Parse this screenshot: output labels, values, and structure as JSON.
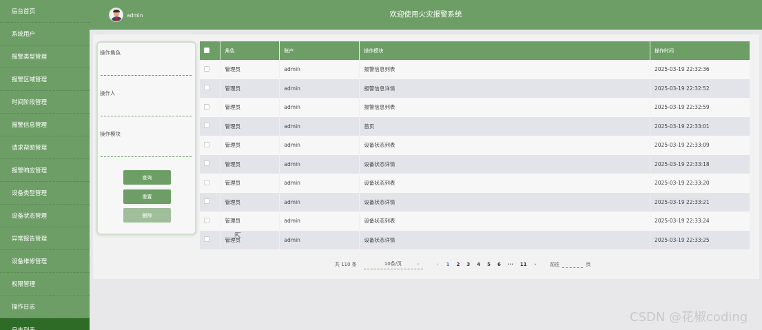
{
  "sidebar": {
    "items": [
      {
        "label": "后台首页"
      },
      {
        "label": "系统用户"
      },
      {
        "label": "报警类型管理"
      },
      {
        "label": "报警区域管理"
      },
      {
        "label": "时间阶段管理"
      },
      {
        "label": "报警信息管理"
      },
      {
        "label": "请求帮助管理"
      },
      {
        "label": "报警响应管理"
      },
      {
        "label": "设备类型管理"
      },
      {
        "label": "设备状态管理"
      },
      {
        "label": "异常报告管理"
      },
      {
        "label": "设备维修管理"
      },
      {
        "label": "权限管理"
      },
      {
        "label": "操作日志"
      },
      {
        "label": "日志列表"
      }
    ],
    "active_index": 14
  },
  "header": {
    "user": "admin",
    "title": "欢迎使用火灾报警系统"
  },
  "filter": {
    "role_label": "操作角色",
    "operator_label": "操作人",
    "module_label": "操作模块",
    "query_label": "查询",
    "reset_label": "重置",
    "delete_label": "删除"
  },
  "table": {
    "headers": {
      "role": "角色",
      "account": "账户",
      "module": "操作模块",
      "time": "操作时间"
    },
    "rows": [
      {
        "role": "管理员",
        "account": "admin",
        "module": "报警信息列表",
        "time": "2025-03-19 22:32:36"
      },
      {
        "role": "管理员",
        "account": "admin",
        "module": "报警信息详情",
        "time": "2025-03-19 22:32:52"
      },
      {
        "role": "管理员",
        "account": "admin",
        "module": "报警信息列表",
        "time": "2025-03-19 22:32:59"
      },
      {
        "role": "管理员",
        "account": "admin",
        "module": "首页",
        "time": "2025-03-19 22:33:01"
      },
      {
        "role": "管理员",
        "account": "admin",
        "module": "设备状态列表",
        "time": "2025-03-19 22:33:09"
      },
      {
        "role": "管理员",
        "account": "admin",
        "module": "设备状态详情",
        "time": "2025-03-19 22:33:18"
      },
      {
        "role": "管理员",
        "account": "admin",
        "module": "设备状态列表",
        "time": "2025-03-19 22:33:20"
      },
      {
        "role": "管理员",
        "account": "admin",
        "module": "设备状态详情",
        "time": "2025-03-19 22:33:21"
      },
      {
        "role": "管理员",
        "account": "admin",
        "module": "设备状态列表",
        "time": "2025-03-19 22:33:24"
      },
      {
        "role": "管理员",
        "account": "admin",
        "module": "设备状态详情",
        "time": "2025-03-19 22:33:25"
      }
    ]
  },
  "pagination": {
    "total": "共 110 条",
    "page_size": "10条/页",
    "pages": [
      "1",
      "2",
      "3",
      "4",
      "5",
      "6",
      "···",
      "11"
    ],
    "current_page": "1",
    "goto_prefix": "前往",
    "goto_suffix": "页"
  },
  "watermark": "CSDN @花椒coding",
  "colors": {
    "primary": "#6d9e66",
    "sidebar_active": "#2e6b26",
    "page_background": "#e8e8ea",
    "current_page": "#4a7ce0"
  }
}
